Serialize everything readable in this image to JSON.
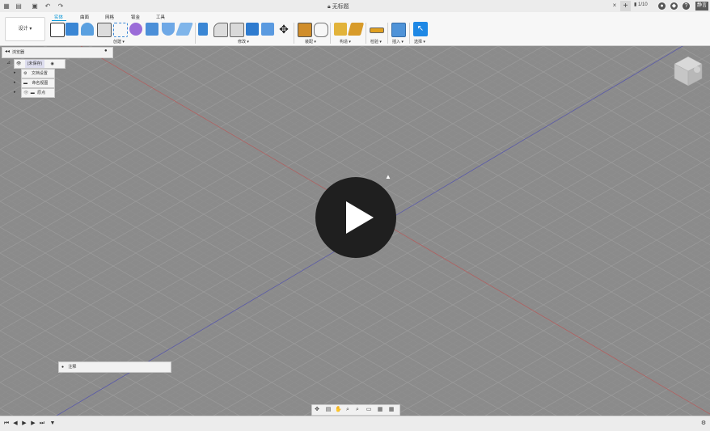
{
  "titlebar": {
    "title": "无标题",
    "user": "静言",
    "job_count": "1/10",
    "icons": [
      "grid-icon",
      "file-icon",
      "save-icon",
      "undo-icon",
      "redo-icon",
      "lock-icon",
      "close-icon",
      "plus-icon",
      "jobs-icon",
      "settings-icon",
      "notifications-icon",
      "help-icon"
    ]
  },
  "ribbon": {
    "workspace": "设计 ▾",
    "tabs": [
      "实体",
      "曲面",
      "网格",
      "钣金",
      "工具"
    ],
    "active_tab": "实体",
    "groups": [
      "创建 ▾",
      "修改 ▾",
      "装配 ▾",
      "构造 ▾",
      "检验 ▾",
      "插入 ▾",
      "选择 ▾"
    ]
  },
  "browser": {
    "title": "浏览器",
    "root": "(未保存)",
    "items": [
      "文档设置",
      "命名视图",
      "原点"
    ]
  },
  "comments": {
    "label": "注释"
  },
  "navbar": {
    "icons": [
      "orbit-icon",
      "look-at-icon",
      "pan-icon",
      "zoom-icon",
      "fit-icon",
      "display-icon",
      "grid-icon",
      "viewport-icon"
    ]
  },
  "timeline": {
    "icons": [
      "first-icon",
      "prev-icon",
      "play-icon",
      "next-icon",
      "last-icon",
      "marker-icon",
      "settings-icon"
    ]
  },
  "colors": {
    "accent": "#0696d7",
    "viewport": "#8d8d8d",
    "play_bg": "#1f1f1f"
  }
}
